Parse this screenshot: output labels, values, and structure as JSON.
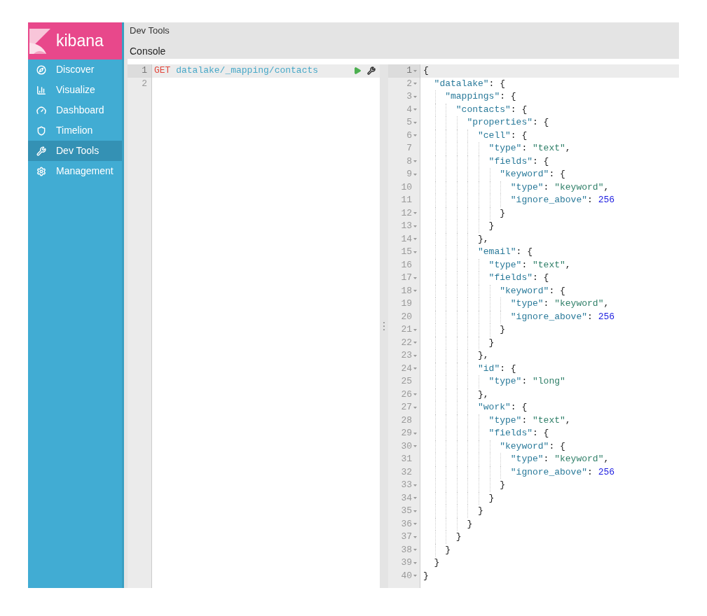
{
  "brand": {
    "name": "kibana"
  },
  "nav": [
    {
      "label": "Discover",
      "selected": false
    },
    {
      "label": "Visualize",
      "selected": false
    },
    {
      "label": "Dashboard",
      "selected": false
    },
    {
      "label": "Timelion",
      "selected": false
    },
    {
      "label": "Dev Tools",
      "selected": true
    },
    {
      "label": "Management",
      "selected": false
    }
  ],
  "header": {
    "title": "Dev Tools",
    "tabs": [
      {
        "label": "Console",
        "selected": true
      }
    ]
  },
  "request": {
    "lines": [
      {
        "number": "1",
        "active": true,
        "method": "GET",
        "url": "datalake/_mapping/contacts"
      },
      {
        "number": "2",
        "active": false
      }
    ]
  },
  "response": {
    "lines": [
      {
        "number": "1",
        "fold": true,
        "active": true,
        "tokens": [
          {
            "kind": "punct",
            "text": "{"
          }
        ]
      },
      {
        "number": "2",
        "fold": true,
        "active": false,
        "tokens": [
          {
            "kind": "key",
            "text": "\"datalake\""
          },
          {
            "kind": "punct",
            "text": ": {"
          }
        ]
      },
      {
        "number": "3",
        "fold": true,
        "active": false,
        "tokens": [
          {
            "kind": "key",
            "text": "\"mappings\""
          },
          {
            "kind": "punct",
            "text": ": {"
          }
        ]
      },
      {
        "number": "4",
        "fold": true,
        "active": false,
        "tokens": [
          {
            "kind": "key",
            "text": "\"contacts\""
          },
          {
            "kind": "punct",
            "text": ": {"
          }
        ]
      },
      {
        "number": "5",
        "fold": true,
        "active": false,
        "tokens": [
          {
            "kind": "key",
            "text": "\"properties\""
          },
          {
            "kind": "punct",
            "text": ": {"
          }
        ]
      },
      {
        "number": "6",
        "fold": true,
        "active": false,
        "tokens": [
          {
            "kind": "key",
            "text": "\"cell\""
          },
          {
            "kind": "punct",
            "text": ": {"
          }
        ]
      },
      {
        "number": "7",
        "fold": false,
        "active": false,
        "tokens": [
          {
            "kind": "key",
            "text": "\"type\""
          },
          {
            "kind": "punct",
            "text": ": "
          },
          {
            "kind": "string",
            "text": "\"text\""
          },
          {
            "kind": "punct",
            "text": ","
          }
        ]
      },
      {
        "number": "8",
        "fold": true,
        "active": false,
        "tokens": [
          {
            "kind": "key",
            "text": "\"fields\""
          },
          {
            "kind": "punct",
            "text": ": {"
          }
        ]
      },
      {
        "number": "9",
        "fold": true,
        "active": false,
        "tokens": [
          {
            "kind": "key",
            "text": "\"keyword\""
          },
          {
            "kind": "punct",
            "text": ": {"
          }
        ]
      },
      {
        "number": "10",
        "fold": false,
        "active": false,
        "tokens": [
          {
            "kind": "key",
            "text": "\"type\""
          },
          {
            "kind": "punct",
            "text": ": "
          },
          {
            "kind": "string",
            "text": "\"keyword\""
          },
          {
            "kind": "punct",
            "text": ","
          }
        ]
      },
      {
        "number": "11",
        "fold": false,
        "active": false,
        "tokens": [
          {
            "kind": "key",
            "text": "\"ignore_above\""
          },
          {
            "kind": "punct",
            "text": ": "
          },
          {
            "kind": "number",
            "text": "256"
          }
        ]
      },
      {
        "number": "12",
        "fold": true,
        "active": false,
        "tokens": [
          {
            "kind": "punct",
            "text": "}"
          }
        ]
      },
      {
        "number": "13",
        "fold": true,
        "active": false,
        "tokens": [
          {
            "kind": "punct",
            "text": "}"
          }
        ]
      },
      {
        "number": "14",
        "fold": true,
        "active": false,
        "tokens": [
          {
            "kind": "punct",
            "text": "},"
          }
        ]
      },
      {
        "number": "15",
        "fold": true,
        "active": false,
        "tokens": [
          {
            "kind": "key",
            "text": "\"email\""
          },
          {
            "kind": "punct",
            "text": ": {"
          }
        ]
      },
      {
        "number": "16",
        "fold": false,
        "active": false,
        "tokens": [
          {
            "kind": "key",
            "text": "\"type\""
          },
          {
            "kind": "punct",
            "text": ": "
          },
          {
            "kind": "string",
            "text": "\"text\""
          },
          {
            "kind": "punct",
            "text": ","
          }
        ]
      },
      {
        "number": "17",
        "fold": true,
        "active": false,
        "tokens": [
          {
            "kind": "key",
            "text": "\"fields\""
          },
          {
            "kind": "punct",
            "text": ": {"
          }
        ]
      },
      {
        "number": "18",
        "fold": true,
        "active": false,
        "tokens": [
          {
            "kind": "key",
            "text": "\"keyword\""
          },
          {
            "kind": "punct",
            "text": ": {"
          }
        ]
      },
      {
        "number": "19",
        "fold": false,
        "active": false,
        "tokens": [
          {
            "kind": "key",
            "text": "\"type\""
          },
          {
            "kind": "punct",
            "text": ": "
          },
          {
            "kind": "string",
            "text": "\"keyword\""
          },
          {
            "kind": "punct",
            "text": ","
          }
        ]
      },
      {
        "number": "20",
        "fold": false,
        "active": false,
        "tokens": [
          {
            "kind": "key",
            "text": "\"ignore_above\""
          },
          {
            "kind": "punct",
            "text": ": "
          },
          {
            "kind": "number",
            "text": "256"
          }
        ]
      },
      {
        "number": "21",
        "fold": true,
        "active": false,
        "tokens": [
          {
            "kind": "punct",
            "text": "}"
          }
        ]
      },
      {
        "number": "22",
        "fold": true,
        "active": false,
        "tokens": [
          {
            "kind": "punct",
            "text": "}"
          }
        ]
      },
      {
        "number": "23",
        "fold": true,
        "active": false,
        "tokens": [
          {
            "kind": "punct",
            "text": "},"
          }
        ]
      },
      {
        "number": "24",
        "fold": true,
        "active": false,
        "tokens": [
          {
            "kind": "key",
            "text": "\"id\""
          },
          {
            "kind": "punct",
            "text": ": {"
          }
        ]
      },
      {
        "number": "25",
        "fold": false,
        "active": false,
        "tokens": [
          {
            "kind": "key",
            "text": "\"type\""
          },
          {
            "kind": "punct",
            "text": ": "
          },
          {
            "kind": "string",
            "text": "\"long\""
          }
        ]
      },
      {
        "number": "26",
        "fold": true,
        "active": false,
        "tokens": [
          {
            "kind": "punct",
            "text": "},"
          }
        ]
      },
      {
        "number": "27",
        "fold": true,
        "active": false,
        "tokens": [
          {
            "kind": "key",
            "text": "\"work\""
          },
          {
            "kind": "punct",
            "text": ": {"
          }
        ]
      },
      {
        "number": "28",
        "fold": false,
        "active": false,
        "tokens": [
          {
            "kind": "key",
            "text": "\"type\""
          },
          {
            "kind": "punct",
            "text": ": "
          },
          {
            "kind": "string",
            "text": "\"text\""
          },
          {
            "kind": "punct",
            "text": ","
          }
        ]
      },
      {
        "number": "29",
        "fold": true,
        "active": false,
        "tokens": [
          {
            "kind": "key",
            "text": "\"fields\""
          },
          {
            "kind": "punct",
            "text": ": {"
          }
        ]
      },
      {
        "number": "30",
        "fold": true,
        "active": false,
        "tokens": [
          {
            "kind": "key",
            "text": "\"keyword\""
          },
          {
            "kind": "punct",
            "text": ": {"
          }
        ]
      },
      {
        "number": "31",
        "fold": false,
        "active": false,
        "tokens": [
          {
            "kind": "key",
            "text": "\"type\""
          },
          {
            "kind": "punct",
            "text": ": "
          },
          {
            "kind": "string",
            "text": "\"keyword\""
          },
          {
            "kind": "punct",
            "text": ","
          }
        ]
      },
      {
        "number": "32",
        "fold": false,
        "active": false,
        "tokens": [
          {
            "kind": "key",
            "text": "\"ignore_above\""
          },
          {
            "kind": "punct",
            "text": ": "
          },
          {
            "kind": "number",
            "text": "256"
          }
        ]
      },
      {
        "number": "33",
        "fold": true,
        "active": false,
        "tokens": [
          {
            "kind": "punct",
            "text": "}"
          }
        ]
      },
      {
        "number": "34",
        "fold": true,
        "active": false,
        "tokens": [
          {
            "kind": "punct",
            "text": "}"
          }
        ]
      },
      {
        "number": "35",
        "fold": true,
        "active": false,
        "tokens": [
          {
            "kind": "punct",
            "text": "}"
          }
        ]
      },
      {
        "number": "36",
        "fold": true,
        "active": false,
        "tokens": [
          {
            "kind": "punct",
            "text": "}"
          }
        ]
      },
      {
        "number": "37",
        "fold": true,
        "active": false,
        "tokens": [
          {
            "kind": "punct",
            "text": "}"
          }
        ]
      },
      {
        "number": "38",
        "fold": true,
        "active": false,
        "tokens": [
          {
            "kind": "punct",
            "text": "}"
          }
        ]
      },
      {
        "number": "39",
        "fold": true,
        "active": false,
        "tokens": [
          {
            "kind": "punct",
            "text": "}"
          }
        ]
      },
      {
        "number": "40",
        "fold": true,
        "active": false,
        "tokens": [
          {
            "kind": "punct",
            "text": "}"
          }
        ]
      }
    ]
  }
}
